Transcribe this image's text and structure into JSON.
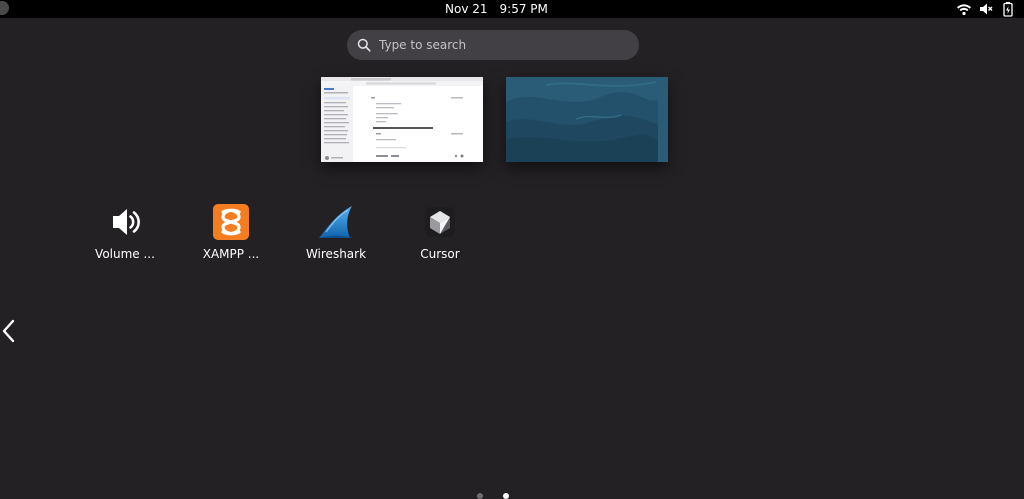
{
  "topbar": {
    "date": "Nov 21",
    "time": "9:57 PM",
    "icons": [
      "activities-indicator",
      "wifi-icon",
      "volume-muted-icon",
      "battery-charging-icon"
    ]
  },
  "search": {
    "placeholder": "Type to search",
    "value": ""
  },
  "workspaces": [
    {
      "name": "workspace-1",
      "content": "browser-window-thumbnail"
    },
    {
      "name": "workspace-2",
      "content": "desktop-wallpaper"
    }
  ],
  "apps": [
    {
      "label": "Volume ...",
      "icon": "speaker-icon"
    },
    {
      "label": "XAMPP ...",
      "icon": "xampp-icon",
      "color": "#f47d20"
    },
    {
      "label": "Wireshark",
      "icon": "wireshark-fin-icon",
      "color": "#1679c5"
    },
    {
      "label": "Cursor",
      "icon": "cursor-cube-icon"
    }
  ],
  "pagination": {
    "pages": 2,
    "current": 2
  },
  "colors": {
    "background": "#242125",
    "topbar": "#000000",
    "search_bg": "#434045",
    "wallpaper": "#2a5c77",
    "xampp_orange": "#f47d20",
    "wireshark_blue": "#1679c5"
  }
}
